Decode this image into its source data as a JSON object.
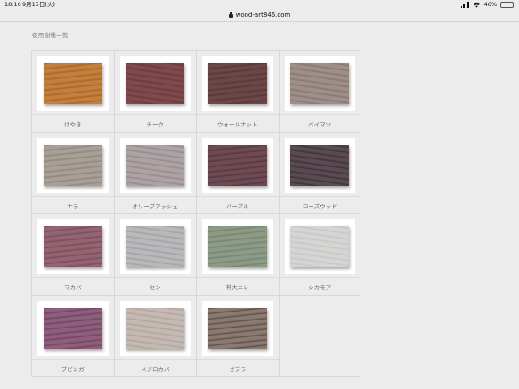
{
  "status": {
    "time": "18:16",
    "date": "9月15日(火)",
    "battery": "46%",
    "battery_level": 0.46
  },
  "browser": {
    "url": "wood-art846.com"
  },
  "page": {
    "title": "使用樹種一覧"
  },
  "woods": [
    {
      "label": "けやき",
      "color": "#c47f3c",
      "grain": "#a8652a"
    },
    {
      "label": "チーク",
      "color": "#7f4a4e",
      "grain": "#6a383c"
    },
    {
      "label": "ウォールナット",
      "color": "#6b4747",
      "grain": "#583636"
    },
    {
      "label": "ベイマツ",
      "color": "#9e8f8a",
      "grain": "#86766f"
    },
    {
      "label": "ナラ",
      "color": "#a89f96",
      "grain": "#90867d"
    },
    {
      "label": "オリーブアッシュ",
      "color": "#aea3a4",
      "grain": "#958a8b"
    },
    {
      "label": "パープル",
      "color": "#6e4a53",
      "grain": "#553740"
    },
    {
      "label": "ローズウッド",
      "color": "#5a4a51",
      "grain": "#3e3238"
    },
    {
      "label": "マカバ",
      "color": "#936471",
      "grain": "#7a4d5a"
    },
    {
      "label": "セン",
      "color": "#b9b9bb",
      "grain": "#a1a1a4"
    },
    {
      "label": "神大ニレ",
      "color": "#8c9a86",
      "grain": "#75836f"
    },
    {
      "label": "シカモア",
      "color": "#d5d5d4",
      "grain": "#c6c6c5"
    },
    {
      "label": "ブビンガ",
      "color": "#8f5e7d",
      "grain": "#6e4560"
    },
    {
      "label": "メジロカバ",
      "color": "#c5bab3",
      "grain": "#b0a49c"
    },
    {
      "label": "ゼブラ",
      "color": "#8a7a72",
      "grain": "#5e5049"
    },
    {
      "label": "",
      "color": "#ececec",
      "grain": "#ececec",
      "empty": true,
      "mark": "………"
    }
  ]
}
